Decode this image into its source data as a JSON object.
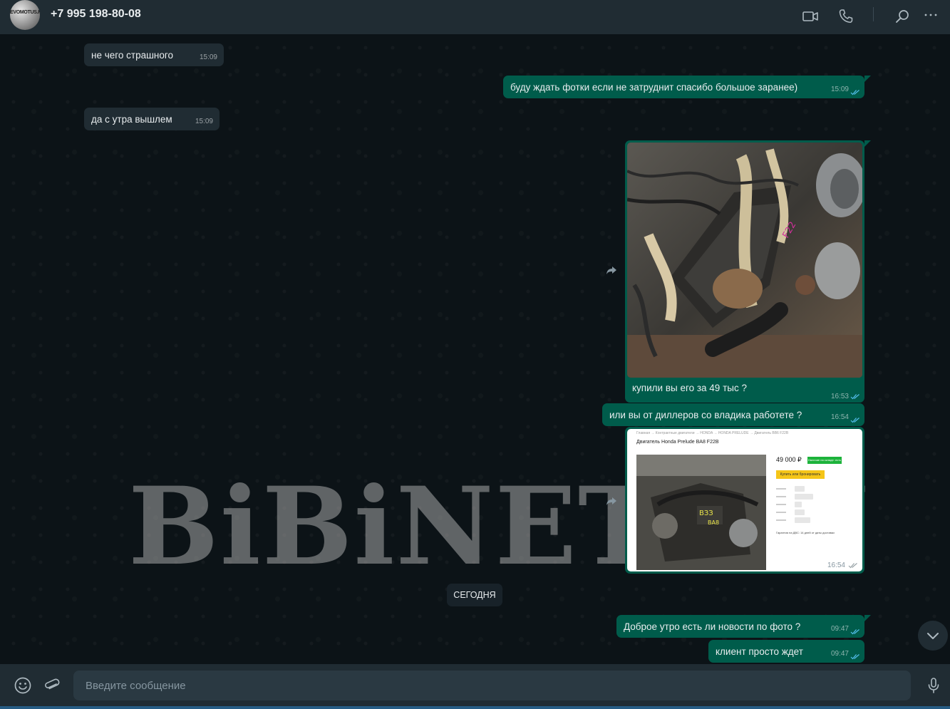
{
  "header": {
    "avatar_text": "EVOMOTUS.RU",
    "contact_name": "+7 995 198-80-08"
  },
  "messages": [
    {
      "direction": "in",
      "text": "не чего страшного",
      "time": "15:09"
    },
    {
      "direction": "out",
      "text": "буду ждать фотки если не затруднит спасибо большое заранее)",
      "time": "15:09",
      "read": true
    },
    {
      "direction": "in",
      "text": "да с утра вышлем",
      "time": "15:09"
    },
    {
      "direction": "out",
      "type": "image",
      "caption": "купили вы его за 49 тыс ?",
      "time": "16:53",
      "read": true
    },
    {
      "direction": "out",
      "text": "или вы от диллеров со владика работете ?",
      "time": "16:54",
      "read": true
    },
    {
      "direction": "out",
      "type": "image",
      "time": "16:54",
      "read": true
    },
    {
      "direction": "out",
      "text": "Доброе утро есть ли новости по фото ?",
      "time": "09:47",
      "read": true
    },
    {
      "direction": "out",
      "text": "клиент просто ждет",
      "time": "09:47",
      "read": true
    }
  ],
  "screenshot": {
    "crumbs": "Главная  →  Контрактные двигатели  →  HONDA  →  HONDA PRELUDE  →  Двигатель BB6 F22B",
    "title": "Двигатель Honda Prelude BA8 F22B",
    "price": "49 000 ₽",
    "stock_badge": "Наличие на складе: есть",
    "buy_label": "Купить или бронировать",
    "note": "Гарантия на ДВС: 14 дней от даты доставки"
  },
  "date_separator": "СЕГОДНЯ",
  "watermark": "BiBiNET.RU",
  "composer": {
    "placeholder": "Введите сообщение"
  },
  "colors": {
    "header_bg": "#202c33",
    "incoming_bubble": "#202c33",
    "outgoing_bubble": "#005c4b",
    "chat_bg": "#0c1317"
  }
}
